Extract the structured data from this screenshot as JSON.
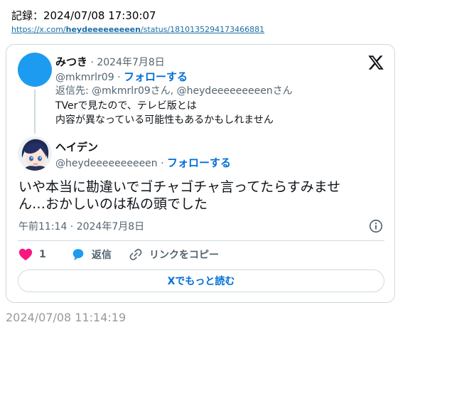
{
  "record": {
    "text": "記録：2024/07/08 17:30:07"
  },
  "url": {
    "prefix": "https://x.com/",
    "handle": "heydeeeeeeeeen",
    "suffix": "/status/1810135294173466881"
  },
  "reply_tweet": {
    "name": "みつき",
    "date": "· 2024年7月8日",
    "handle": "@mkmrlr09",
    "sep": "·",
    "follow": "フォローする",
    "reply_to": "返信先: @mkmrlr09さん, @heydeeeeeeeeenさん",
    "lines": [
      "TVerで見たので、テレビ版とは",
      "内容が異なっている可能性もあるかもしれません"
    ],
    "avatar_color": "#1d9bf0"
  },
  "main_tweet": {
    "name": "ヘイデン",
    "handle": "@heydeeeeeeeeeen",
    "sep": "·",
    "follow": "フォローする",
    "lines": [
      "いや本当に勘違いでゴチャゴチャ言ってたらすみませ",
      "ん…おかしいのは私の頭でした"
    ],
    "timestamp": "午前11:14 · 2024年7月8日"
  },
  "actions": {
    "like_count": "1",
    "reply_label": "返信",
    "copy_label": "リンクをコピー"
  },
  "read_more": "Xでもっと読む",
  "footer_time": "2024/07/08 11:14:19",
  "colors": {
    "accent": "#006fd6",
    "like": "#f91880",
    "reply": "#1d9bf0",
    "border": "#cfd9de",
    "muted": "#536471"
  }
}
